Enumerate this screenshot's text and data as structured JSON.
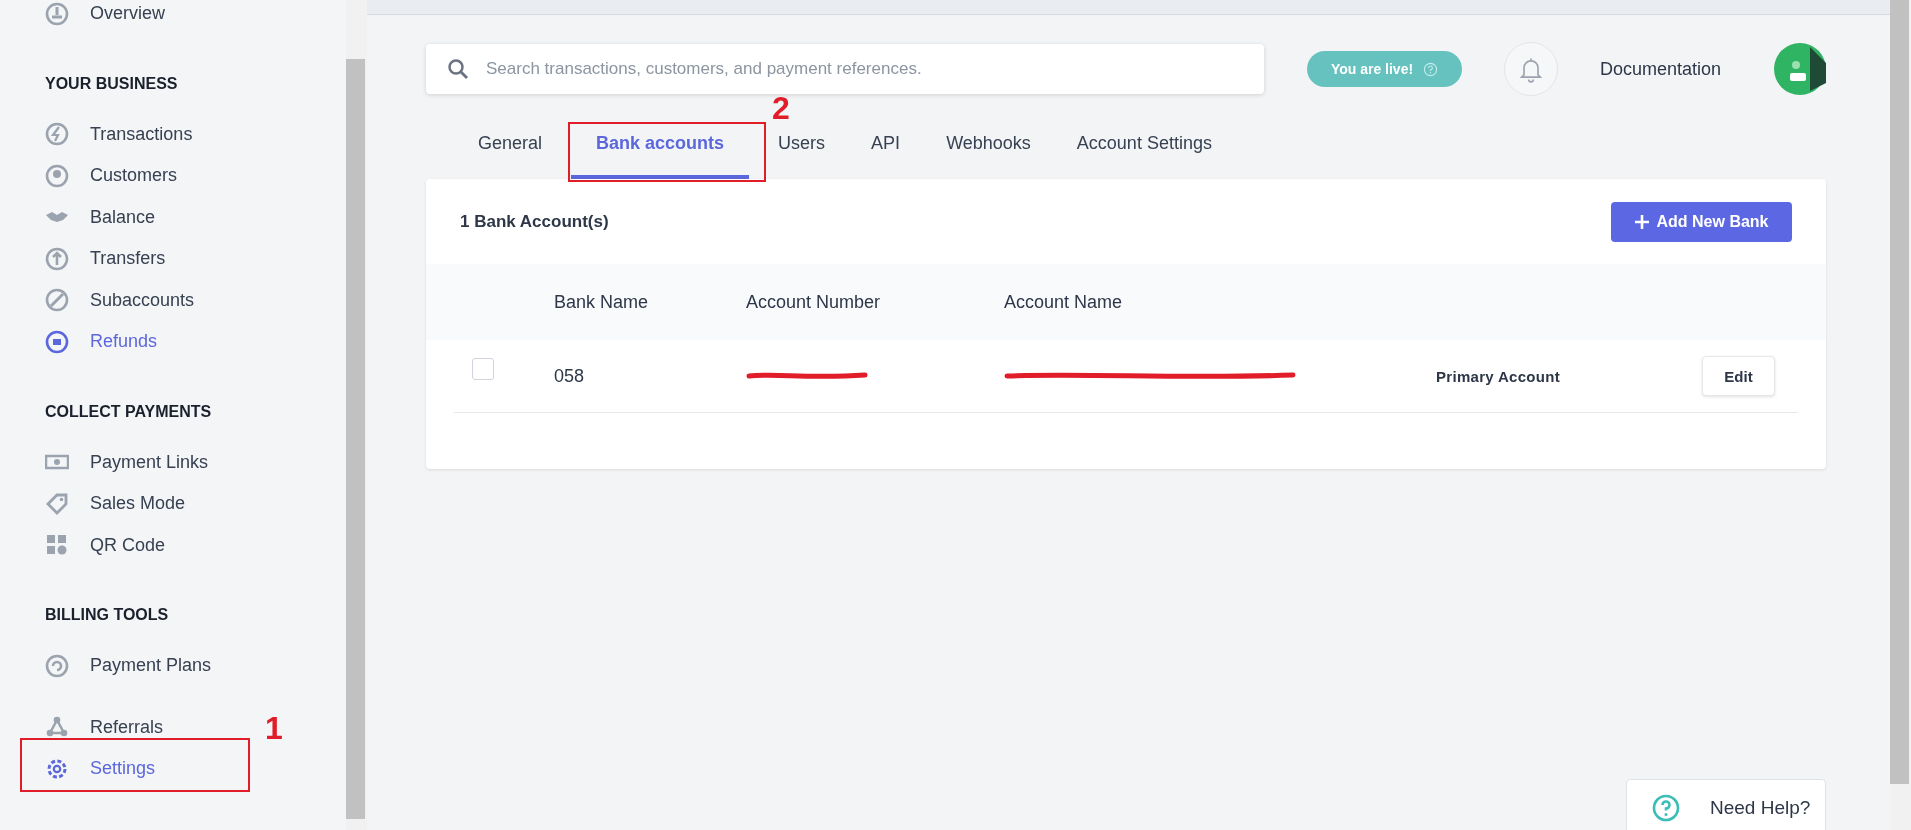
{
  "sidebar": {
    "groups": [
      {
        "items": [
          {
            "label": "Overview",
            "highlighted": false
          }
        ]
      },
      {
        "heading": "YOUR BUSINESS",
        "items": [
          {
            "label": "Transactions",
            "highlighted": false
          },
          {
            "label": "Customers",
            "highlighted": false
          },
          {
            "label": "Balance",
            "highlighted": false
          },
          {
            "label": "Transfers",
            "highlighted": false
          },
          {
            "label": "Subaccounts",
            "highlighted": false
          },
          {
            "label": "Refunds",
            "highlighted": true
          }
        ]
      },
      {
        "heading": "COLLECT PAYMENTS",
        "items": [
          {
            "label": "Payment Links",
            "highlighted": false
          },
          {
            "label": "Sales Mode",
            "highlighted": false
          },
          {
            "label": "QR Code",
            "highlighted": false
          }
        ]
      },
      {
        "heading": "BILLING TOOLS",
        "items": [
          {
            "label": "Payment Plans",
            "highlighted": false
          }
        ]
      },
      {
        "items": [
          {
            "label": "Referrals",
            "highlighted": false
          },
          {
            "label": "Settings",
            "highlighted": true
          }
        ]
      }
    ]
  },
  "header": {
    "search": {
      "placeholder": "Search transactions, customers, and payment references."
    },
    "live_badge": "You are live!",
    "docs_link": "Documentation"
  },
  "tabs": [
    {
      "label": "General",
      "selected": false
    },
    {
      "label": "Bank accounts",
      "selected": true
    },
    {
      "label": "Users",
      "selected": false
    },
    {
      "label": "API",
      "selected": false
    },
    {
      "label": "Webhooks",
      "selected": false
    },
    {
      "label": "Account Settings",
      "selected": false
    }
  ],
  "card": {
    "title": "1 Bank Account(s)",
    "add_button": "Add New Bank",
    "table": {
      "columns": [
        "Bank Name",
        "Account Number",
        "Account Name"
      ],
      "rows": [
        {
          "checked": false,
          "bank_name": "058",
          "account_number": {
            "redacted": true
          },
          "account_name": {
            "redacted": true
          },
          "status": "Primary Account",
          "action": "Edit"
        }
      ]
    }
  },
  "help": {
    "label": "Need Help?"
  },
  "annotations": [
    {
      "label": "1"
    },
    {
      "label": "2"
    }
  ]
}
